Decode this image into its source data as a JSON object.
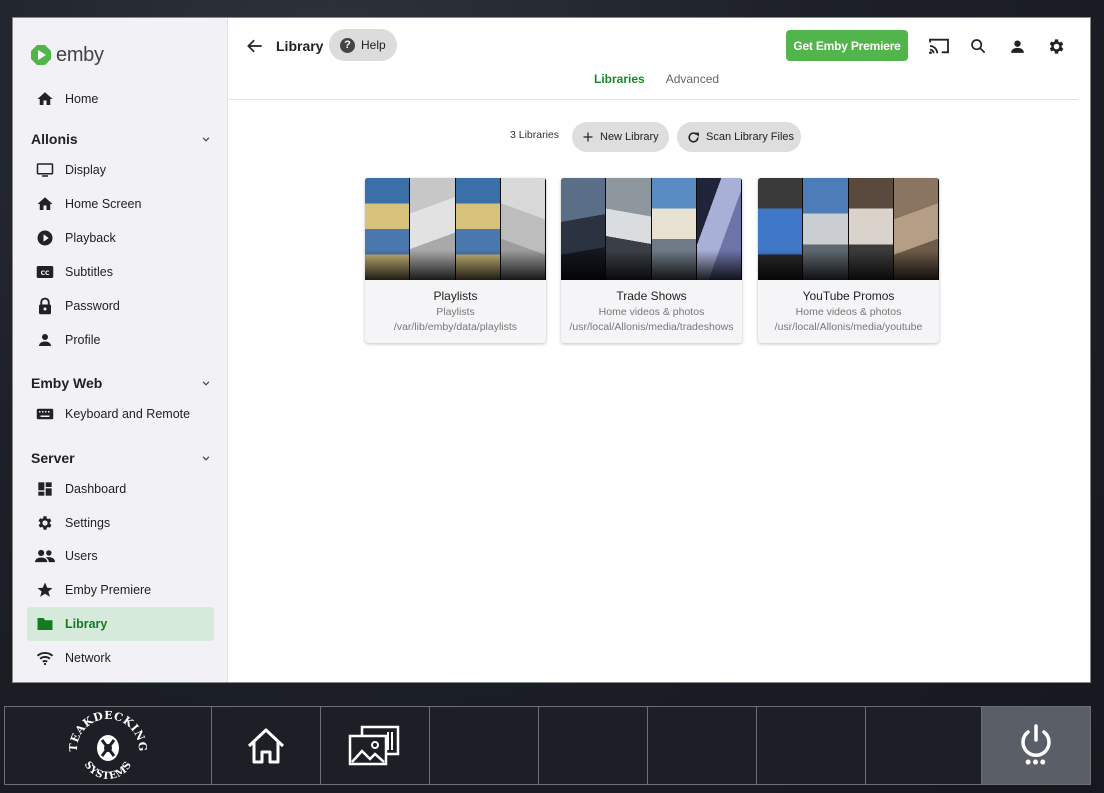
{
  "app": {
    "brand": "emby"
  },
  "sidebar": {
    "home": "Home",
    "sections": [
      {
        "title": "Allonis",
        "items": [
          "Display",
          "Home Screen",
          "Playback",
          "Subtitles",
          "Password",
          "Profile"
        ]
      },
      {
        "title": "Emby Web",
        "items": [
          "Keyboard and Remote"
        ]
      },
      {
        "title": "Server",
        "items": [
          "Dashboard",
          "Settings",
          "Users",
          "Emby Premiere",
          "Library",
          "Network"
        ]
      }
    ],
    "active_item": "Library"
  },
  "header": {
    "title": "Library",
    "help_label": "Help",
    "premiere_label": "Get Emby Premiere",
    "tabs": [
      {
        "label": "Libraries",
        "active": true
      },
      {
        "label": "Advanced",
        "active": false
      }
    ]
  },
  "toolbar": {
    "count_label": "3 Libraries",
    "new_library_label": "New Library",
    "scan_label": "Scan Library Files"
  },
  "libraries": [
    {
      "name": "Playlists",
      "type": "Playlists",
      "path": "/var/lib/emby/data/playlists"
    },
    {
      "name": "Trade Shows",
      "type": "Home videos & photos",
      "path": "/usr/local/Allonis/media/tradeshows"
    },
    {
      "name": "YouTube Promos",
      "type": "Home videos & photos",
      "path": "/usr/local/Allonis/media/youtube"
    }
  ],
  "taskbar": {
    "logo_text": "TEAKDECKING SYSTEMS",
    "buttons": [
      "home-icon",
      "media-gallery-icon",
      "empty",
      "empty",
      "empty",
      "empty",
      "empty",
      "power-icon"
    ]
  },
  "colors": {
    "accent": "#52b54b",
    "active_text": "#137a1f",
    "active_bg": "#d6eadb"
  }
}
